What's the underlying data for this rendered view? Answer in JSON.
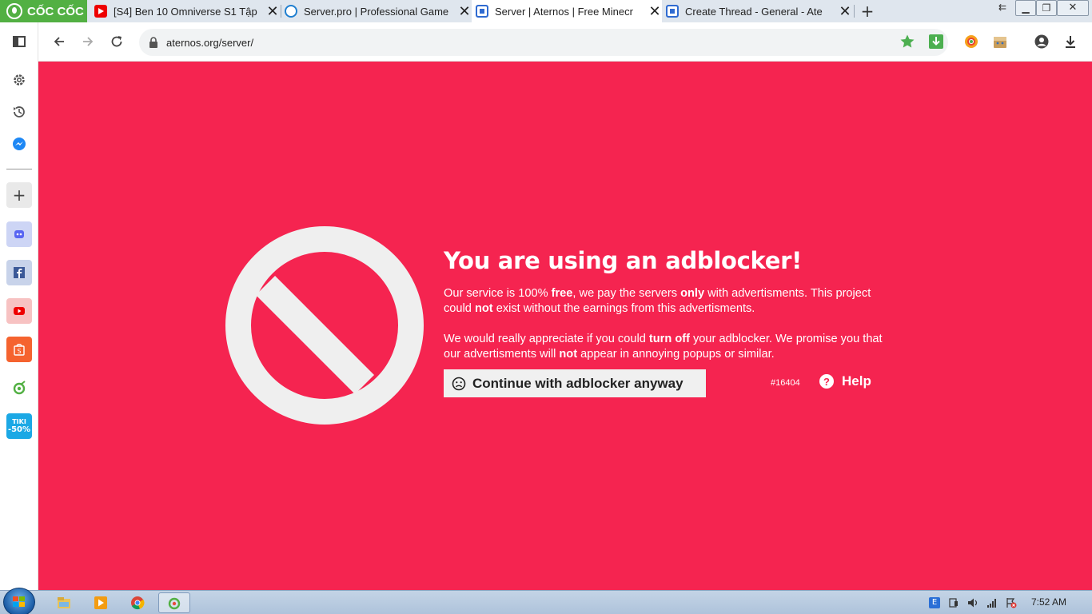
{
  "browser": {
    "brand": "CỐC CỐC",
    "tabs": [
      {
        "title": "[S4] Ben 10 Omniverse S1 Tập",
        "icon": "youtube-icon",
        "active": false
      },
      {
        "title": "Server.pro | Professional Game",
        "icon": "serverpro-icon",
        "active": false
      },
      {
        "title": "Server | Aternos | Free Minecr",
        "icon": "aternos-icon",
        "active": true
      },
      {
        "title": "Create Thread - General - Ate",
        "icon": "aternos-icon",
        "active": false
      }
    ],
    "url": "aternos.org/server/"
  },
  "sidebar": {
    "items": [
      "settings-icon",
      "history-icon",
      "messenger-icon",
      "add-icon",
      "discord-icon",
      "facebook-icon",
      "youtube-icon",
      "shopee-icon",
      "coccoc-icon",
      "tiki-icon"
    ],
    "tiki_label": "TIKI",
    "tiki_badge": "-50%"
  },
  "page": {
    "title": "You are using an adblocker!",
    "para1": [
      {
        "t": "Our service is 100% ",
        "b": false
      },
      {
        "t": "free",
        "b": true
      },
      {
        "t": ", we pay the servers ",
        "b": false
      },
      {
        "t": "only",
        "b": true
      },
      {
        "t": " with advertisments. This project could ",
        "b": false
      },
      {
        "t": "not",
        "b": true
      },
      {
        "t": " exist without the earnings from this advertisments.",
        "b": false
      }
    ],
    "para2": [
      {
        "t": "We would really appreciate if you could ",
        "b": false
      },
      {
        "t": "turn off",
        "b": true
      },
      {
        "t": " your adblocker. We promise you that our advertisments will ",
        "b": false
      },
      {
        "t": "not",
        "b": true
      },
      {
        "t": " appear in annoying popups or similar.",
        "b": false
      }
    ],
    "continue_label": "Continue with adblocker anyway",
    "error_code": "#16404",
    "help_label": "Help",
    "background_color": "#f52450"
  },
  "taskbar": {
    "clock": "7:52 AM"
  }
}
